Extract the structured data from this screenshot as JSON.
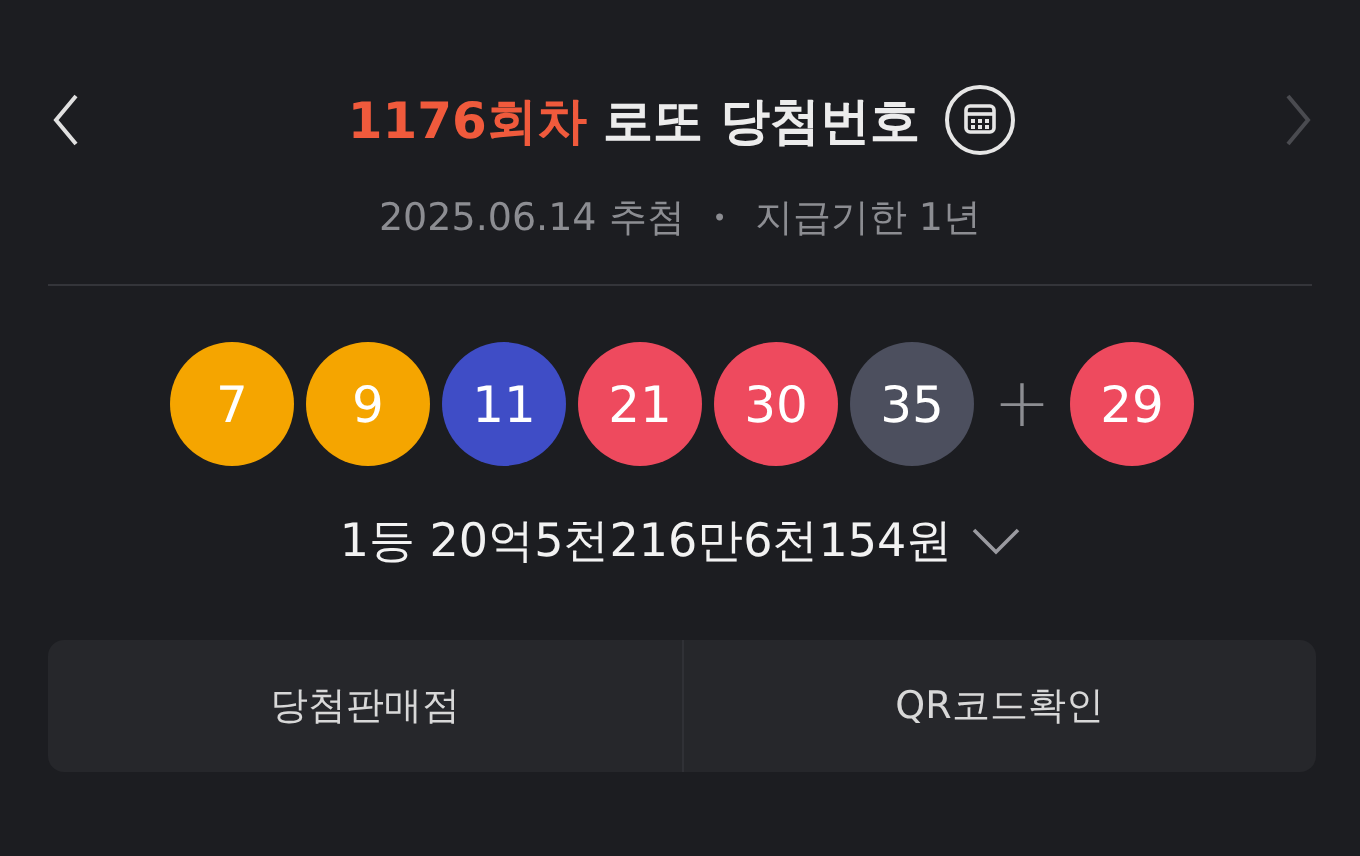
{
  "header": {
    "round": "1176회차",
    "title": "로또 당첨번호",
    "prev_disabled": false,
    "next_disabled": true
  },
  "subtitle": {
    "date": "2025.06.14 추첨",
    "separator": "•",
    "deadline": "지급기한 1년"
  },
  "numbers": [
    {
      "value": "7",
      "color": "#f5a500"
    },
    {
      "value": "9",
      "color": "#f5a500"
    },
    {
      "value": "11",
      "color": "#3f4dc6"
    },
    {
      "value": "21",
      "color": "#ee4a5e"
    },
    {
      "value": "30",
      "color": "#ee4a5e"
    },
    {
      "value": "35",
      "color": "#4c4f5e"
    }
  ],
  "plus": "+",
  "bonus": {
    "value": "29",
    "color": "#ee4a5e"
  },
  "prize": "1등 20억5천216만6천154원",
  "buttons": [
    "당첨판매점",
    "QR코드확인"
  ]
}
